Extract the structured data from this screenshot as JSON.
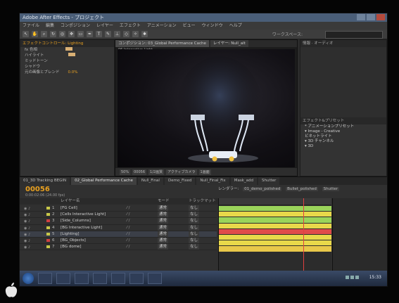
{
  "window": {
    "title": "Adobe After Effects - プロジェクト"
  },
  "menu": [
    "ファイル",
    "編集",
    "コンポジション",
    "レイヤー",
    "エフェクト",
    "アニメーション",
    "ビュー",
    "ウィンドウ",
    "ヘルプ"
  ],
  "workspace_label": "ワークスペース:",
  "effects_panel": {
    "tab": "エフェクトコントロール: Lighting",
    "rows": [
      {
        "name": "fx 色相",
        "swatch": true
      },
      {
        "name": "ハイライト",
        "swatch": true
      },
      {
        "name": "ミッドトーン",
        "swatch": false
      },
      {
        "name": "シャドウ",
        "swatch": false
      },
      {
        "name": "元の画像とブレンド",
        "value": "0.0%"
      }
    ]
  },
  "viewer": {
    "tabs": [
      "コンポジション: 03_Global Performance Cache",
      "レイヤー: Null_alt"
    ],
    "subtab": "06 Interactive Light",
    "zoom": "50%",
    "timecode": "00056",
    "quality": "1/2画質",
    "camera": "アクティブカメラ",
    "views": "1画面"
  },
  "right_panel": {
    "tab": "情報",
    "tab2": "オーディオ",
    "presets_tab": "エフェクト&プリセット",
    "tree": [
      "* アニメーションプリセット",
      "▾ Image - Creative",
      "  ビネットライト",
      "▾ 3D チャンネル",
      "▾ 3D"
    ]
  },
  "timeline": {
    "tabs": [
      "01_3D Tracking BEGIN",
      "02_Global Performance Cache",
      "Null_Final",
      "Demo_Fixed",
      "Null_Final_Fix",
      "Mask_add",
      "Shutter"
    ],
    "timecode": "00056",
    "timecode_sub": "0:00:02:06 (24.00 fps)",
    "columns": {
      "name": "レイヤー名",
      "mode": "モード",
      "track": "トラックマット",
      "render": "レンダラー:"
    },
    "render_tabs": [
      "01_demo_polished",
      "Bullet_polished",
      "Shutter"
    ],
    "layers": [
      {
        "num": "1",
        "name": "[FG Cell]",
        "mode": "通常",
        "track": "なし",
        "color": "#c8c84a"
      },
      {
        "num": "2",
        "name": "[Cells Interactive Light]",
        "mode": "通常",
        "track": "なし",
        "color": "#c8c84a"
      },
      {
        "num": "3",
        "name": "[Side_Columns]",
        "mode": "通常",
        "track": "なし",
        "color": "#d04040"
      },
      {
        "num": "4",
        "name": "[BG Interactive Light]",
        "mode": "通常",
        "track": "なし",
        "color": "#c8c84a"
      },
      {
        "num": "5",
        "name": "[Lighting]",
        "mode": "通常",
        "track": "なし",
        "color": "#c8c84a"
      },
      {
        "num": "6",
        "name": "[BG_Objects]",
        "mode": "通常",
        "track": "なし",
        "color": "#d04040"
      },
      {
        "num": "7",
        "name": "[BG dome]",
        "mode": "通常",
        "track": "なし",
        "color": "#c8c84a"
      }
    ],
    "track_colors": [
      "#9ad45a",
      "#e8d84a",
      "#9ad45a",
      "#e8d84a",
      "#e04a4a",
      "#e8d84a",
      "#e8d84a",
      "#e8c84a"
    ]
  },
  "taskbar": {
    "clock": "15:33"
  },
  "colors": {
    "accent": "#e8a020",
    "panel": "#333333",
    "taskbar": "#1f2a3d"
  }
}
